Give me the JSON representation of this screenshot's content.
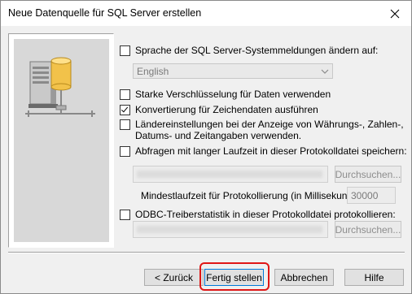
{
  "window": {
    "title": "Neue Datenquelle für SQL Server erstellen"
  },
  "options": {
    "language": {
      "label": "Sprache der SQL Server-Systemmeldungen ändern auf:",
      "checked": false,
      "selected_value": "English"
    },
    "strong_encryption": {
      "label": "Starke Verschlüsselung für Daten verwenden",
      "checked": false
    },
    "character_conversion": {
      "label": "Konvertierung für Zeichendaten ausführen",
      "checked": true
    },
    "regional_settings": {
      "label_line1": "Ländereinstellungen bei der Anzeige von Währungs-, Zahlen-,",
      "label_line2": "Datums- und Zeitangaben verwenden.",
      "checked": false
    },
    "long_queries": {
      "label": "Abfragen mit langer Laufzeit in dieser Protokolldatei speichern:",
      "checked": false,
      "browse_label": "Durchsuchen...",
      "min_runtime_label": "Mindestlaufzeit für Protokollierung (in Millisekunden):",
      "min_runtime_value": "30000"
    },
    "odbc_stats": {
      "label": "ODBC-Treiberstatistik in dieser Protokolldatei protokollieren:",
      "checked": false,
      "browse_label": "Durchsuchen..."
    }
  },
  "buttons": {
    "back": "< Zurück",
    "finish": "Fertig stellen",
    "cancel": "Abbrechen",
    "help": "Hilfe"
  },
  "colors": {
    "highlight": "#e01515",
    "default_button_border": "#0078d7"
  }
}
